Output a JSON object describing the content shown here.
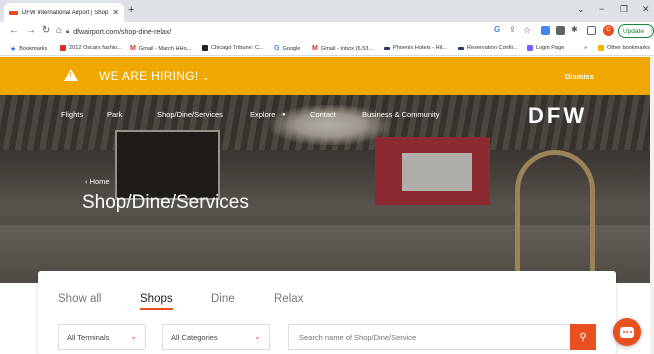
{
  "browser": {
    "tab_title": "DFW International Airport | Shop",
    "url": "dfwairport.com/shop-dine-relax/",
    "profile_initial": "C",
    "update_label": "Update",
    "bookmarks": [
      {
        "label": "Bookmarks",
        "color": "#1a73e8"
      },
      {
        "label": "2012 Oscars fashio...",
        "color": "#d93025"
      },
      {
        "label": "Gmail - March HHo...",
        "color": "#d93025"
      },
      {
        "label": "Chicago Tribune: C...",
        "color": "#222222"
      },
      {
        "label": "Google",
        "color": "#4285f4"
      },
      {
        "label": "Gmail - Inbox (6,53...",
        "color": "#d93025"
      },
      {
        "label": "Phoenix Hotels - Hil...",
        "color": "#1e3a6e"
      },
      {
        "label": "Reservation Confir...",
        "color": "#1e3a6e"
      },
      {
        "label": "Login Page",
        "color": "#7b61ff"
      },
      {
        "label": "Other bookmarks",
        "color": "#f4b400"
      }
    ]
  },
  "alert": {
    "message": "WE ARE HIRING!",
    "dismiss_label": "Dismiss",
    "color": "#f0a800"
  },
  "nav": {
    "items": [
      "Flights",
      "Park",
      "Shop/Dine/Services",
      "Explore",
      "Contact",
      "Business & Community"
    ],
    "logo": "DFW"
  },
  "hero": {
    "breadcrumb": "‹ Home",
    "title": "Shop/Dine/Services"
  },
  "filters": {
    "tabs": [
      "Show all",
      "Shops",
      "Dine",
      "Relax"
    ],
    "active_tab": "Shops",
    "terminals_value": "All Terminals",
    "categories_value": "All Categories",
    "search_placeholder": "Search name of Shop/Dine/Service",
    "accent": "#e8511f"
  }
}
